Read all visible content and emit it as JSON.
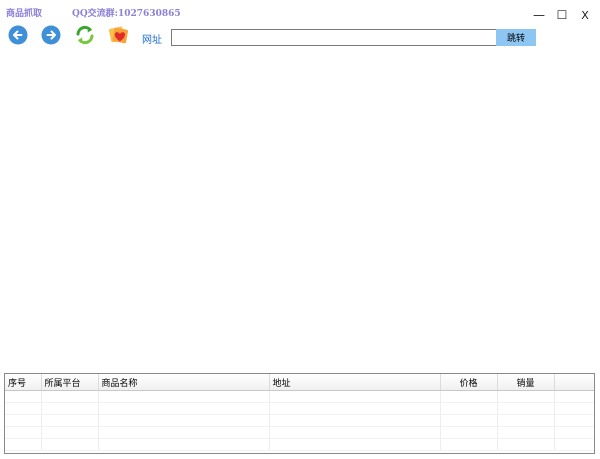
{
  "app": {
    "title": "商品抓取",
    "qq_group": "QQ交流群:1027630865"
  },
  "window_controls": {
    "minimize": "—",
    "maximize": "☐",
    "close": "X"
  },
  "toolbar": {
    "url_label": "网址",
    "url_value": "",
    "go_label": "跳转"
  },
  "icons": {
    "back": "back-arrow-icon",
    "forward": "forward-arrow-icon",
    "refresh": "refresh-icon",
    "favorite": "favorite-heart-icon"
  },
  "colors": {
    "title": "#8b80d8",
    "accent_blue": "#3f8fd9",
    "button": "#8ec6f3"
  },
  "table": {
    "columns": [
      "序号",
      "所属平台",
      "商品名称",
      "地址",
      "价格",
      "销量"
    ],
    "rows": []
  }
}
